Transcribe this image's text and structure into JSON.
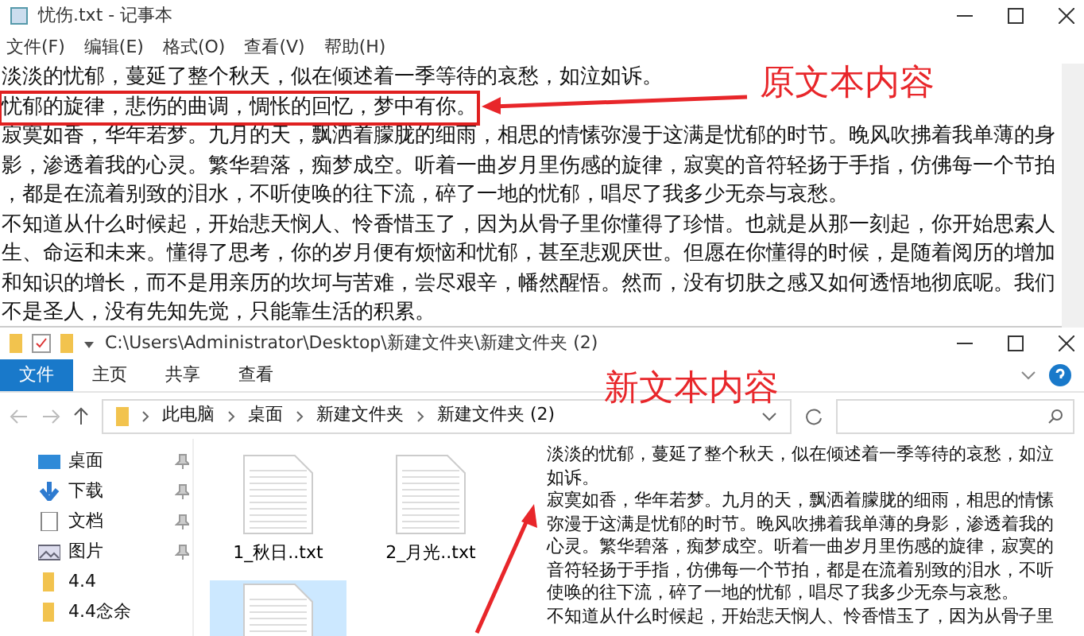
{
  "notepad": {
    "title": "忧伤.txt - 记事本",
    "menu": [
      "文件(F)",
      "编辑(E)",
      "格式(O)",
      "查看(V)",
      "帮助(H)"
    ],
    "lines": [
      {
        "text": "淡淡的忧郁，蔓延了整个秋天，似在倾述着一季等待的哀愁，如泣如诉。",
        "highlighted": false
      },
      {
        "text": "忧郁的旋律，悲伤的曲调，惆怅的回忆，梦中有你。",
        "highlighted": true
      },
      {
        "text": "寂寞如香，华年若梦。九月的天，飘洒着朦胧的细雨，相思的情愫弥漫于这满是忧郁的时节。晚风吹拂着我单薄的身",
        "highlighted": false
      },
      {
        "text": "影，渗透着我的心灵。繁华碧落，痴梦成空。听着一曲岁月里伤感的旋律，寂寞的音符轻扬于手指，仿佛每一个节拍",
        "highlighted": false
      },
      {
        "text": "，都是在流着别致的泪水，不听使唤的往下流，碎了一地的忧郁，唱尽了我多少无奈与哀愁。",
        "highlighted": false
      },
      {
        "text": "不知道从什么时候起，开始悲天悯人、怜香惜玉了，因为从骨子里你懂得了珍惜。也就是从那一刻起，你开始思索人",
        "highlighted": false
      },
      {
        "text": "生、命运和未来。懂得了思考，你的岁月便有烦恼和忧郁，甚至悲观厌世。但愿在你懂得的时候，是随着阅历的增加",
        "highlighted": false
      },
      {
        "text": "和知识的增长，而不是用亲历的坎坷与苦难，尝尽艰辛，幡然醒悟。然而，没有切肤之感又如何透悟地彻底呢。我们",
        "highlighted": false
      },
      {
        "text": "不是圣人，没有先知先觉，只能靠生活的积累。",
        "highlighted": false
      }
    ]
  },
  "explorer": {
    "title": "C:\\Users\\Administrator\\Desktop\\新建文件夹\\新建文件夹 (2)",
    "tabs": [
      {
        "label": "文件",
        "selected": true
      },
      {
        "label": "主页",
        "selected": false
      },
      {
        "label": "共享",
        "selected": false
      },
      {
        "label": "查看",
        "selected": false
      }
    ],
    "breadcrumbs": [
      "此电脑",
      "桌面",
      "新建文件夹",
      "新建文件夹 (2)"
    ],
    "nav": [
      {
        "label": "桌面",
        "kind": "desktop",
        "pinned": true
      },
      {
        "label": "下载",
        "kind": "download",
        "pinned": true
      },
      {
        "label": "文档",
        "kind": "document",
        "pinned": true
      },
      {
        "label": "图片",
        "kind": "picture",
        "pinned": true
      },
      {
        "label": "4.4",
        "kind": "folder",
        "pinned": false
      },
      {
        "label": "4.4念余",
        "kind": "folder",
        "pinned": false
      }
    ],
    "files": [
      {
        "name": "1_秋日..txt",
        "selected": false
      },
      {
        "name": "2_月光..txt",
        "selected": false
      },
      {
        "selected": true
      }
    ],
    "preview": [
      "淡淡的忧郁，蔓延了整个秋天，似在倾述着一季等待的哀愁，如泣",
      "如诉。",
      "寂寞如香，华年若梦。九月的天，飘洒着朦胧的细雨，相思的情愫",
      "弥漫于这满是忧郁的时节。晚风吹拂着我单薄的身影，渗透着我的",
      "心灵。繁华碧落，痴梦成空。听着一曲岁月里伤感的旋律，寂寞的",
      "音符轻扬于手指，仿佛每一个节拍，都是在流着别致的泪水，不听",
      "使唤的往下流，碎了一地的忧郁，唱尽了我多少无奈与哀愁。",
      "不知道从什么时候起，开始悲天悯人、怜香惜玉了，因为从骨子里"
    ]
  },
  "annotations": [
    "原文本内容",
    "新文本内容"
  ]
}
